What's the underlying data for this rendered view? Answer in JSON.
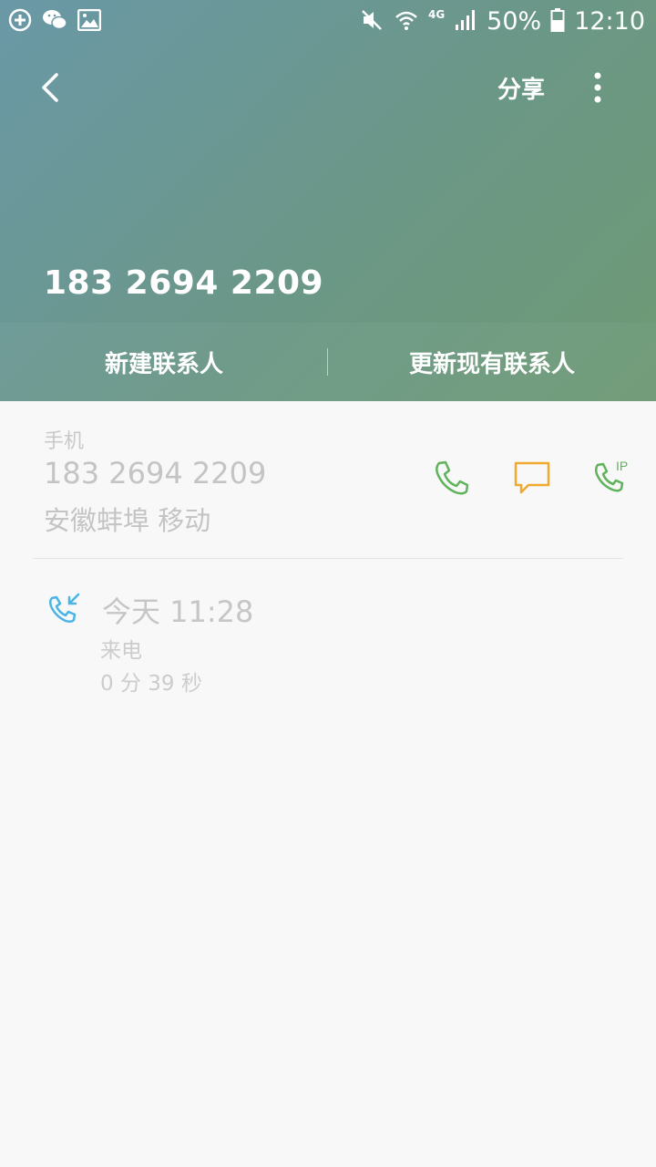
{
  "status_bar": {
    "left_icons": [
      "add-circle-icon",
      "wechat-icon",
      "image-icon"
    ],
    "right_icons": [
      "mute-icon",
      "wifi-icon",
      "signal-icon",
      "battery-icon"
    ],
    "network": "4G",
    "battery": "50%",
    "time": "12:10"
  },
  "toolbar": {
    "back_icon": "chevron-left-icon",
    "share_label": "分享",
    "more_icon": "more-vertical-icon"
  },
  "header": {
    "number": "183 2694 2209"
  },
  "actions": {
    "new_contact": "新建联系人",
    "update_contact": "更新现有联系人"
  },
  "contact": {
    "label": "手机",
    "phone": "183 2694 2209",
    "location": "安徽蚌埠 移动",
    "call_icon": "phone-icon",
    "message_icon": "message-icon",
    "ip_call_icon": "ip-phone-icon",
    "ip_label": "IP"
  },
  "call_log": {
    "icon": "incoming-call-icon",
    "time": "今天 11:28",
    "type": "来电",
    "duration": "0 分 39 秒"
  },
  "colors": {
    "call_green": "#5fb35a",
    "message_orange": "#f0a830",
    "incoming_blue": "#4ab4e6"
  }
}
